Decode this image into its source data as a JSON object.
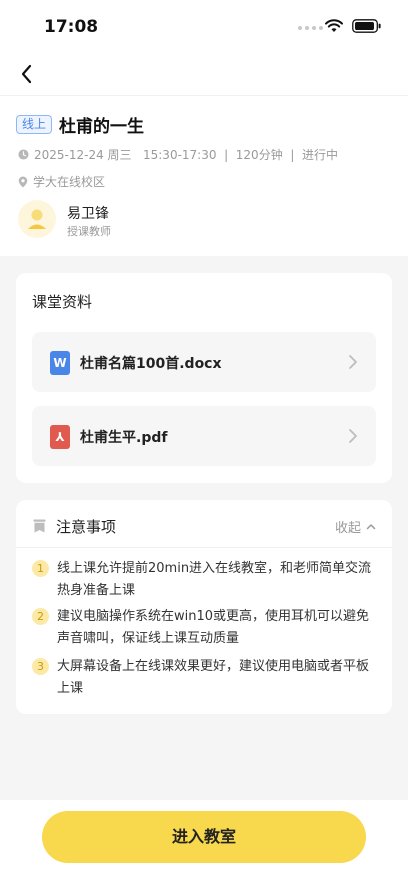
{
  "status_bar": {
    "time": "17:08"
  },
  "course": {
    "tag": "线上",
    "title": "杜甫的一生",
    "datetime": "2025-12-24 周三   15:30-17:30  |  120分钟  |  进行中",
    "location": "学大在线校区"
  },
  "teacher": {
    "name": "易卫锋",
    "role": "授课教师"
  },
  "materials": {
    "title": "课堂资料",
    "files": [
      {
        "name": "杜甫名篇100首.docx",
        "icon": "word-doc-icon",
        "icon_glyph": "W",
        "color": "#4a86e8"
      },
      {
        "name": "杜甫生平.pdf",
        "icon": "pdf-icon",
        "icon_glyph": "⅄",
        "color": "#e05a4f"
      }
    ]
  },
  "notice": {
    "title": "注意事项",
    "collapse_label": "收起",
    "items": [
      {
        "num": "1",
        "text": "线上课允许提前20min进入在线教室，和老师简单交流热身准备上课"
      },
      {
        "num": "2",
        "text": "建议电脑操作系统在win10或更高，使用耳机可以避免声音啸叫，保证线上课互动质量"
      },
      {
        "num": "3",
        "text": "大屏幕设备上在线课效果更好，建议使用电脑或者平板上课"
      }
    ]
  },
  "action": {
    "enter_label": "进入教室"
  },
  "colors": {
    "accent": "#f8d84c",
    "tag_blue": "#4a86e8",
    "notice_num_bg": "#fde9a6"
  }
}
